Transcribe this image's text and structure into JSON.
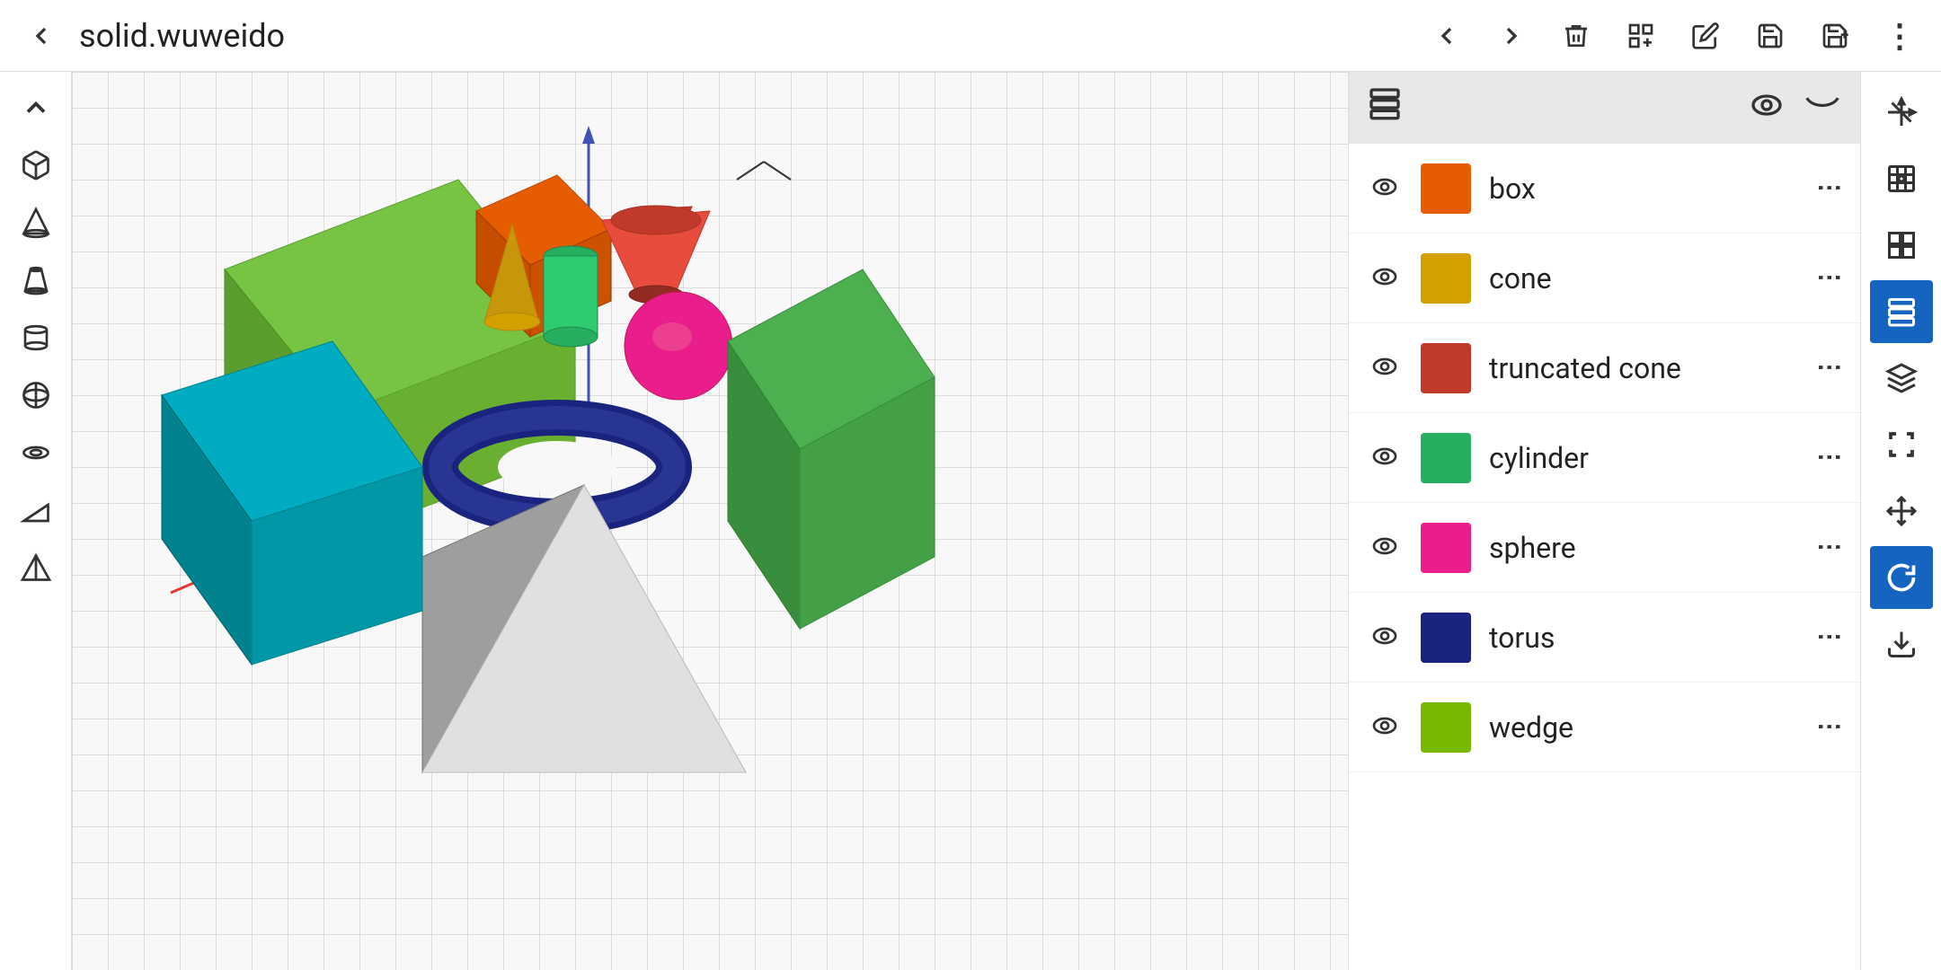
{
  "header": {
    "title": "solid.wuweido",
    "back_label": "←",
    "nav": {
      "back": "←",
      "forward": "→",
      "delete": "🗑",
      "add": "⊞",
      "edit": "✏",
      "save": "💾",
      "save_plus": "💾+",
      "more": "⋮"
    }
  },
  "left_toolbar": {
    "tools": [
      {
        "name": "collapse",
        "icon": "∧"
      },
      {
        "name": "box-tool",
        "icon": "☐"
      },
      {
        "name": "cone-tool",
        "icon": "△"
      },
      {
        "name": "truncated-cone-tool",
        "icon": "⌂"
      },
      {
        "name": "cylinder-tool",
        "icon": "⊓"
      },
      {
        "name": "sphere-tool",
        "icon": "⊙"
      },
      {
        "name": "torus-tool",
        "icon": "◎"
      },
      {
        "name": "wedge-tool",
        "icon": "◁"
      },
      {
        "name": "pyramid-tool",
        "icon": "▲"
      }
    ]
  },
  "layers_panel": {
    "header_icon": "layers",
    "show_all": "👁",
    "hide_all": "〜",
    "items": [
      {
        "name": "box",
        "color": "#e65c00",
        "visible": true,
        "color_label": "orange"
      },
      {
        "name": "cone",
        "color": "#d4a000",
        "visible": true,
        "color_label": "gold"
      },
      {
        "name": "truncated cone",
        "color": "#c0392b",
        "visible": true,
        "color_label": "red"
      },
      {
        "name": "cylinder",
        "color": "#27ae60",
        "visible": true,
        "color_label": "green"
      },
      {
        "name": "sphere",
        "color": "#e91e8c",
        "visible": true,
        "color_label": "magenta"
      },
      {
        "name": "torus",
        "color": "#1a237e",
        "visible": true,
        "color_label": "dark blue"
      },
      {
        "name": "wedge",
        "color": "#76b900",
        "visible": true,
        "color_label": "lime green"
      }
    ]
  },
  "right_toolbar": {
    "tools": [
      {
        "name": "3d-axis",
        "icon": "⊹"
      },
      {
        "name": "perspective",
        "icon": "◈"
      },
      {
        "name": "grid",
        "icon": "⊞"
      },
      {
        "name": "layers-active",
        "icon": "▤"
      },
      {
        "name": "stack",
        "icon": "⊟"
      },
      {
        "name": "frame",
        "icon": "⬚"
      },
      {
        "name": "move",
        "icon": "⊕"
      },
      {
        "name": "rotate-active",
        "icon": "↺"
      },
      {
        "name": "export",
        "icon": "↓"
      }
    ]
  },
  "scene": {
    "shapes": [
      {
        "type": "box",
        "color": "#e65c00"
      },
      {
        "type": "cone",
        "color": "#d4a000"
      },
      {
        "type": "truncated_cone",
        "color": "#c0392b"
      },
      {
        "type": "cylinder",
        "color": "#27ae60"
      },
      {
        "type": "sphere",
        "color": "#e91e8c"
      },
      {
        "type": "torus",
        "color": "#1a237e"
      },
      {
        "type": "wedge",
        "color": "#4caf50"
      },
      {
        "type": "box_large",
        "color": "#4caf50"
      },
      {
        "type": "pyramid",
        "color": "#9e9e9e"
      },
      {
        "type": "box_teal",
        "color": "#00838f"
      }
    ]
  }
}
